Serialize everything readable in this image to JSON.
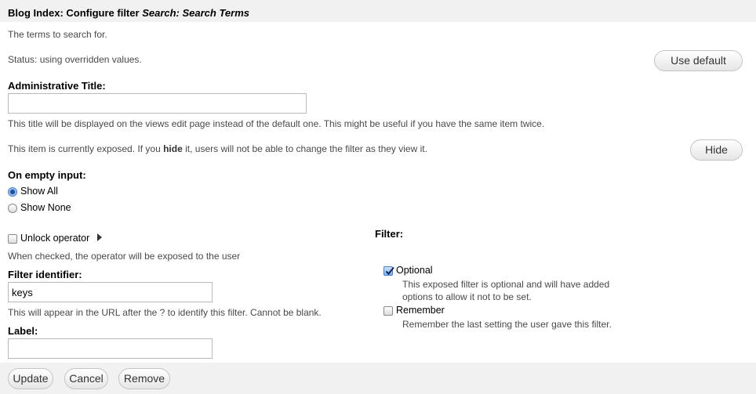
{
  "header": {
    "title_plain": "Blog Index: Configure filter",
    "title_emph": "Search: Search Terms"
  },
  "description": "The terms to search for.",
  "status_text": "Status: using overridden values.",
  "use_default_label": "Use default",
  "admin_title": {
    "label": "Administrative Title:",
    "value": "",
    "help": "This title will be displayed on the views edit page instead of the default one. This might be useful if you have the same item twice."
  },
  "exposed_notice": {
    "before": "This item is currently exposed. If you",
    "bold": "hide",
    "after": "it, users will not be able to change the filter as they view it."
  },
  "hide_label": "Hide",
  "empty_input": {
    "label": "On empty input:",
    "options": [
      "Show All",
      "Show None"
    ],
    "selected": "Show All"
  },
  "unlock_operator": {
    "label": "Unlock operator",
    "checked": false,
    "help": "When checked, the operator will be exposed to the user"
  },
  "filter_identifier": {
    "label": "Filter identifier:",
    "value": "keys",
    "help": "This will appear in the URL after the ? to identify this filter. Cannot be blank."
  },
  "label_field": {
    "label": "Label:",
    "value": ""
  },
  "filter_section": {
    "label": "Filter:",
    "optional": {
      "label": "Optional",
      "checked": true,
      "help_line1": "This exposed filter is optional and will have added",
      "help_line2": "options to allow it not to be set."
    },
    "remember": {
      "label": "Remember",
      "checked": false,
      "help": "Remember the last setting the user gave this filter."
    }
  },
  "footer": {
    "update_label": "Update",
    "cancel_label": "Cancel",
    "remove_label": "Remove"
  }
}
